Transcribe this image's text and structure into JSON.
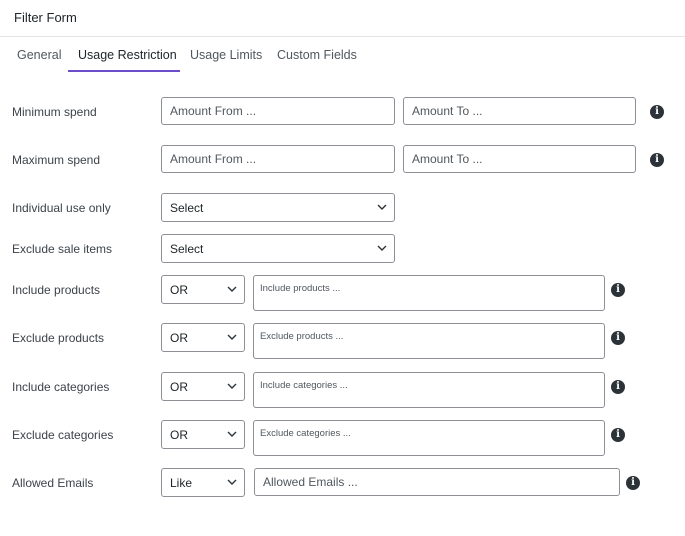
{
  "title": "Filter Form",
  "tabs": [
    "General",
    "Usage Restriction",
    "Usage Limits",
    "Custom Fields"
  ],
  "active_tab": "Usage Restriction",
  "rows": {
    "min_spend": {
      "label": "Minimum spend",
      "from_placeholder": "Amount From ...",
      "to_placeholder": "Amount To ..."
    },
    "max_spend": {
      "label": "Maximum spend",
      "from_placeholder": "Amount From ...",
      "to_placeholder": "Amount To ..."
    },
    "individual_use": {
      "label": "Individual use only",
      "value": "Select"
    },
    "exclude_sale": {
      "label": "Exclude sale items",
      "value": "Select"
    },
    "include_products": {
      "label": "Include products",
      "operator": "OR",
      "placeholder": "Include products ..."
    },
    "exclude_products": {
      "label": "Exclude products",
      "operator": "OR",
      "placeholder": "Exclude products ..."
    },
    "include_categories": {
      "label": "Include categories",
      "operator": "OR",
      "placeholder": "Include categories ..."
    },
    "exclude_categories": {
      "label": "Exclude categories",
      "operator": "OR",
      "placeholder": "Exclude categories ..."
    },
    "allowed_emails": {
      "label": "Allowed Emails",
      "operator": "Like",
      "placeholder": "Allowed Emails ..."
    }
  },
  "icons": {
    "info": "info-icon",
    "chevron": "chevron-down-icon"
  },
  "colors": {
    "accent": "#6a4dc7",
    "border": "#8c8f94",
    "info_bg": "#2c3338"
  }
}
